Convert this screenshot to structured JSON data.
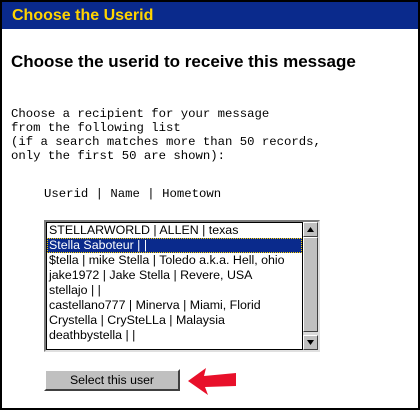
{
  "window": {
    "title": "Choose the Userid"
  },
  "heading": "Choose the userid to receive this message",
  "instructions": [
    "Choose a recipient for your message",
    "from the following list",
    "(if a search matches more than 50 records,",
    "only the first 50 are shown):"
  ],
  "columns_header": "Userid | Name | Hometown",
  "user_list": {
    "options": [
      "STELLARWORLD | ALLEN | texas",
      "Stella Saboteur | |",
      "$tella | mike Stella | Toledo a.k.a. Hell, ohio",
      "jake1972 | Jake Stella | Revere, USA",
      "stellajo | |",
      "castellano777 | Minerva | Miami, Florid",
      "Crystella | CrySteLLa | Malaysia",
      "deathbystella | |"
    ],
    "selected_index": 1
  },
  "select_button_label": "Select this user",
  "colors": {
    "titlebar_bg": "#0a2a8c",
    "title_text": "#ffd400",
    "arrow": "#e8102a"
  },
  "icons": {
    "scroll_up": "up-arrow-icon",
    "scroll_down": "down-arrow-icon",
    "pointer": "red-arrow-icon"
  }
}
